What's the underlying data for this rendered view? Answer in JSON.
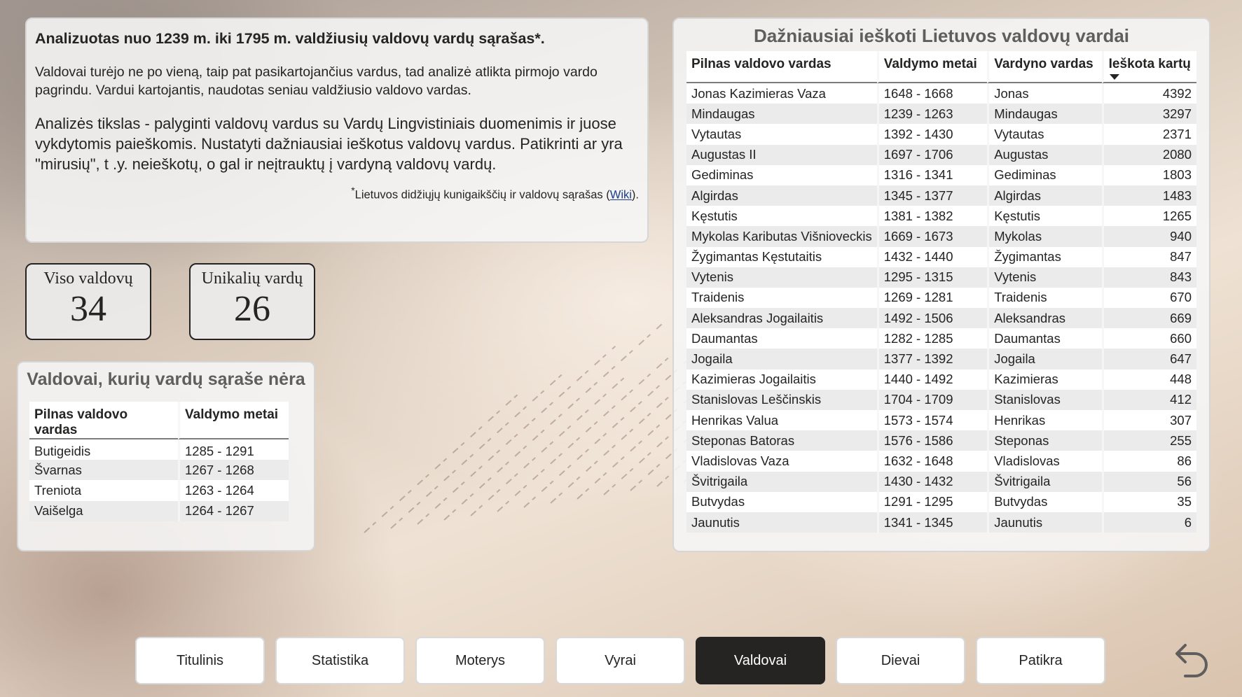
{
  "intro": {
    "title": "Analizuotas nuo 1239 m. iki 1795 m. valdžiusių valdovų vardų sąrašas*.",
    "p1": "Valdovai turėjo ne po vieną, taip pat pasikartojančius vardus, tad analizė atlikta pirmojo vardo pagrindu. Vardui kartojantis, naudotas seniau valdžiusio valdovo vardas.",
    "p2": "Analizės tikslas - palyginti valdovų vardus su Vardų Lingvistiniais duomenimis ir juose vykdytomis paieškomis. Nustatyti dažniausiai ieškotus valdovų vardus. Patikrinti ar yra \"mirusių\", t .y. neieškotų, o gal ir neįtrauktų į vardyną valdovų vardų.",
    "note_star": "*",
    "note_text": "Lietuvos didžiųjų kunigaikščių ir valdovų sąrašas (",
    "note_link": "Wiki",
    "note_end": ")."
  },
  "kpis": {
    "total_label": "Viso valdovų",
    "total_value": "34",
    "unique_label": "Unikalių vardų",
    "unique_value": "26"
  },
  "missing": {
    "title": "Valdovai, kurių vardų sąraše nėra",
    "columns": [
      "Pilnas valdovo vardas",
      "Valdymo metai"
    ],
    "rows": [
      [
        "Butigeidis",
        "1285 - 1291"
      ],
      [
        "Švarnas",
        "1267 - 1268"
      ],
      [
        "Treniota",
        "1263 - 1264"
      ],
      [
        "Vaišelga",
        "1264 - 1267"
      ]
    ]
  },
  "top": {
    "title": "Dažniausiai ieškoti Lietuvos valdovų vardai",
    "columns": [
      "Pilnas valdovo vardas",
      "Valdymo metai",
      "Vardyno vardas",
      "Ieškota kartų"
    ],
    "rows": [
      [
        "Jonas Kazimieras Vaza",
        "1648 - 1668",
        "Jonas",
        "4392"
      ],
      [
        "Mindaugas",
        "1239 - 1263",
        "Mindaugas",
        "3297"
      ],
      [
        "Vytautas",
        "1392 - 1430",
        "Vytautas",
        "2371"
      ],
      [
        "Augustas II",
        "1697 - 1706",
        "Augustas",
        "2080"
      ],
      [
        "Gediminas",
        "1316 - 1341",
        "Gediminas",
        "1803"
      ],
      [
        "Algirdas",
        "1345 - 1377",
        "Algirdas",
        "1483"
      ],
      [
        "Kęstutis",
        "1381 - 1382",
        "Kęstutis",
        "1265"
      ],
      [
        "Mykolas Kaributas Višnioveckis",
        "1669 - 1673",
        "Mykolas",
        "940"
      ],
      [
        "Žygimantas Kęstutaitis",
        "1432 - 1440",
        "Žygimantas",
        "847"
      ],
      [
        "Vytenis",
        "1295 - 1315",
        "Vytenis",
        "843"
      ],
      [
        "Traidenis",
        "1269 - 1281",
        "Traidenis",
        "670"
      ],
      [
        "Aleksandras Jogailaitis",
        "1492 - 1506",
        "Aleksandras",
        "669"
      ],
      [
        "Daumantas",
        "1282 - 1285",
        "Daumantas",
        "660"
      ],
      [
        "Jogaila",
        "1377 - 1392",
        "Jogaila",
        "647"
      ],
      [
        "Kazimieras Jogailaitis",
        "1440 - 1492",
        "Kazimieras",
        "448"
      ],
      [
        "Stanislovas Leščinskis",
        "1704 - 1709",
        "Stanislovas",
        "412"
      ],
      [
        "Henrikas Valua",
        "1573 - 1574",
        "Henrikas",
        "307"
      ],
      [
        "Steponas Batoras",
        "1576 - 1586",
        "Steponas",
        "255"
      ],
      [
        "Vladislovas Vaza",
        "1632 - 1648",
        "Vladislovas",
        "86"
      ],
      [
        "Švitrigaila",
        "1430 - 1432",
        "Švitrigaila",
        "56"
      ],
      [
        "Butvydas",
        "1291 - 1295",
        "Butvydas",
        "35"
      ],
      [
        "Jaunutis",
        "1341 - 1345",
        "Jaunutis",
        "6"
      ]
    ]
  },
  "nav": [
    {
      "label": "Titulinis",
      "active": false
    },
    {
      "label": "Statistika",
      "active": false
    },
    {
      "label": "Moterys",
      "active": false
    },
    {
      "label": "Vyrai",
      "active": false
    },
    {
      "label": "Valdovai",
      "active": true
    },
    {
      "label": "Dievai",
      "active": false
    },
    {
      "label": "Patikra",
      "active": false
    }
  ],
  "icons": {
    "back": "back-arrow-icon",
    "sort": "sort-descending-icon"
  },
  "colors": {
    "active_nav": "#252423",
    "card_title": "#605e5c",
    "link": "#1b3c8a"
  }
}
